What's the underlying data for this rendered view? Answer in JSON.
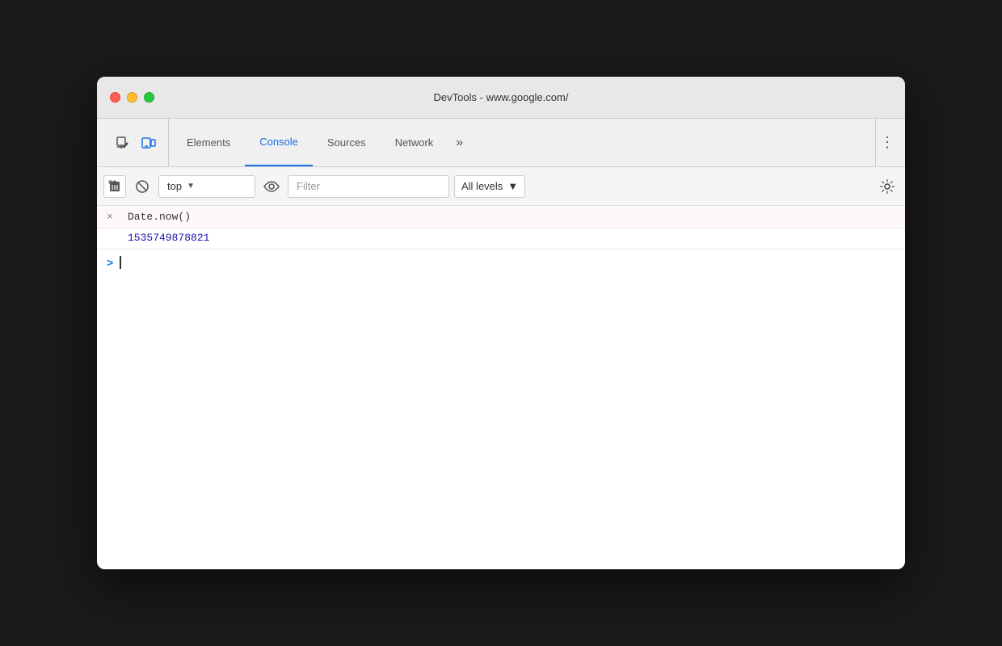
{
  "window": {
    "title": "DevTools - www.google.com/",
    "traffic_lights": {
      "close": "close",
      "minimize": "minimize",
      "maximize": "maximize"
    }
  },
  "tabs": {
    "items": [
      {
        "id": "elements",
        "label": "Elements",
        "active": false
      },
      {
        "id": "console",
        "label": "Console",
        "active": true
      },
      {
        "id": "sources",
        "label": "Sources",
        "active": false
      },
      {
        "id": "network",
        "label": "Network",
        "active": false
      },
      {
        "id": "more",
        "label": "»",
        "active": false
      }
    ]
  },
  "toolbar": {
    "context_value": "top",
    "context_placeholder": "top",
    "filter_placeholder": "Filter",
    "levels_label": "All levels",
    "clear_label": "Clear console",
    "block_label": "Block network requests"
  },
  "console": {
    "entries": [
      {
        "prefix": "×",
        "command": "Date.now()",
        "result": "1535749878821"
      }
    ],
    "prompt_symbol": ">",
    "input_value": ""
  }
}
